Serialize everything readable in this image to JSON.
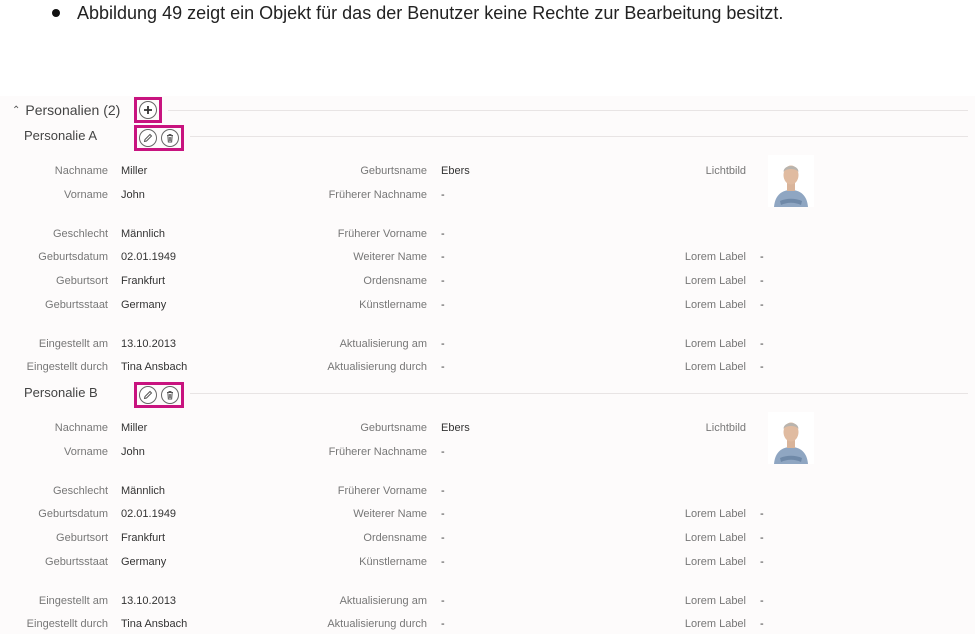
{
  "intro_text": "Abbildung 49 zeigt ein Objekt für das der Benutzer keine Rechte zur Bearbeitung besitzt.",
  "section": {
    "title": "Personalien (2)"
  },
  "colors": {
    "highlight": "#c8137f",
    "panel_bg": "#fdfbfb"
  },
  "icons": {
    "add": "plus-circle-icon",
    "edit": "pencil-icon",
    "delete": "trash-icon"
  },
  "records": [
    {
      "title": "Personalie A",
      "col1": [
        {
          "label": "Nachname",
          "value": "Miller"
        },
        {
          "label": "Vorname",
          "value": "John"
        },
        {
          "label": "Geschlecht",
          "value": "Männlich"
        },
        {
          "label": "Geburtsdatum",
          "value": "02.01.1949"
        },
        {
          "label": "Geburtsort",
          "value": "Frankfurt"
        },
        {
          "label": "Geburtsstaat",
          "value": "Germany"
        },
        {
          "label": "Eingestellt am",
          "value": "13.10.2013"
        },
        {
          "label": "Eingestellt durch",
          "value": "Tina Ansbach"
        }
      ],
      "col2": [
        {
          "label": "Geburtsname",
          "value": "Ebers"
        },
        {
          "label": "Früherer Nachname",
          "value": "-"
        },
        {
          "label": "Früherer Vorname",
          "value": "-"
        },
        {
          "label": "Weiterer Name",
          "value": "-"
        },
        {
          "label": "Ordensname",
          "value": "-"
        },
        {
          "label": "Künstlername",
          "value": "-"
        },
        {
          "label": "Aktualisierung am",
          "value": "-"
        },
        {
          "label": "Aktualisierung durch",
          "value": "-"
        }
      ],
      "col3": [
        {
          "label": "Lichtbild",
          "value": ""
        },
        {
          "label": "Lorem Label",
          "value": "-"
        },
        {
          "label": "Lorem Label",
          "value": "-"
        },
        {
          "label": "Lorem Label",
          "value": "-"
        },
        {
          "label": "Lorem Label",
          "value": "-"
        },
        {
          "label": "Lorem Label",
          "value": "-"
        }
      ]
    },
    {
      "title": "Personalie B",
      "col1": [
        {
          "label": "Nachname",
          "value": "Miller"
        },
        {
          "label": "Vorname",
          "value": "John"
        },
        {
          "label": "Geschlecht",
          "value": "Männlich"
        },
        {
          "label": "Geburtsdatum",
          "value": "02.01.1949"
        },
        {
          "label": "Geburtsort",
          "value": "Frankfurt"
        },
        {
          "label": "Geburtsstaat",
          "value": "Germany"
        },
        {
          "label": "Eingestellt am",
          "value": "13.10.2013"
        },
        {
          "label": "Eingestellt durch",
          "value": "Tina Ansbach"
        }
      ],
      "col2": [
        {
          "label": "Geburtsname",
          "value": "Ebers"
        },
        {
          "label": "Früherer Nachname",
          "value": "-"
        },
        {
          "label": "Früherer Vorname",
          "value": "-"
        },
        {
          "label": "Weiterer Name",
          "value": "-"
        },
        {
          "label": "Ordensname",
          "value": "-"
        },
        {
          "label": "Künstlername",
          "value": "-"
        },
        {
          "label": "Aktualisierung am",
          "value": "-"
        },
        {
          "label": "Aktualisierung durch",
          "value": "-"
        }
      ],
      "col3": [
        {
          "label": "Lichtbild",
          "value": ""
        },
        {
          "label": "Lorem Label",
          "value": "-"
        },
        {
          "label": "Lorem Label",
          "value": "-"
        },
        {
          "label": "Lorem Label",
          "value": "-"
        },
        {
          "label": "Lorem Label",
          "value": "-"
        },
        {
          "label": "Lorem Label",
          "value": "-"
        }
      ]
    }
  ]
}
